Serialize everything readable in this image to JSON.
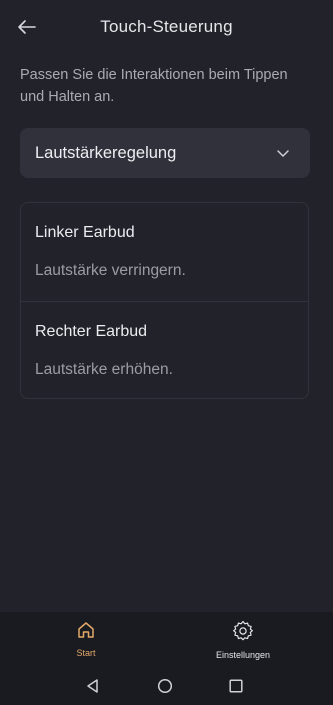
{
  "header": {
    "title": "Touch-Steuerung",
    "back_icon": "arrow-left-icon"
  },
  "description": "Passen Sie die Interaktionen beim Tippen und Halten an.",
  "dropdown": {
    "selected": "Lautstärkeregelung",
    "icon": "chevron-down-icon"
  },
  "earbuds": [
    {
      "title": "Linker Earbud",
      "value": "Lautstärke verringern."
    },
    {
      "title": "Rechter Earbud",
      "value": "Lautstärke erhöhen."
    }
  ],
  "bottom_nav": {
    "items": [
      {
        "label": "Start",
        "icon": "home-icon",
        "active": true
      },
      {
        "label": "Einstellungen",
        "icon": "gear-icon",
        "active": false
      }
    ]
  },
  "system_nav": [
    "back-triangle-icon",
    "home-circle-icon",
    "recents-square-icon"
  ],
  "colors": {
    "background": "#22232a",
    "surface": "#30313a",
    "accent": "#e3a968",
    "nav": "#1a1b21"
  }
}
